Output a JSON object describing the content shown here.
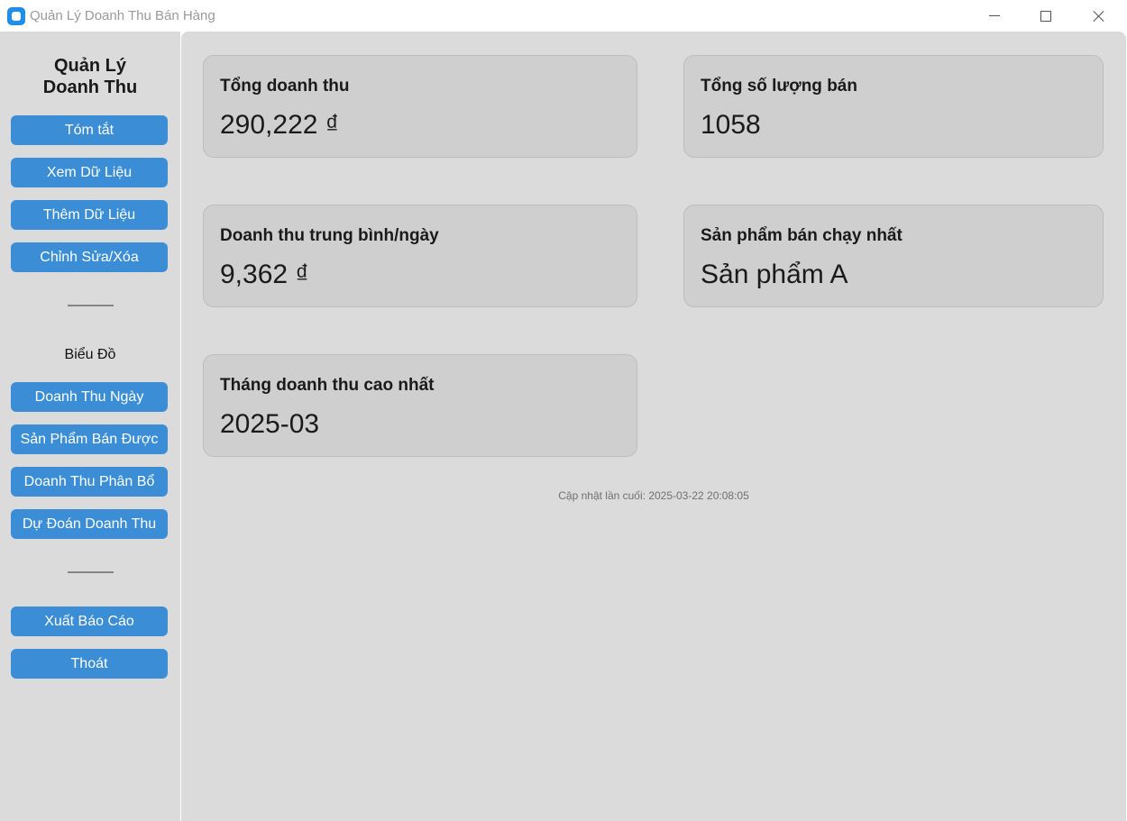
{
  "window": {
    "title": "Quản Lý Doanh Thu Bán Hàng",
    "controls": [
      "minimize-icon",
      "maximize-icon",
      "close-icon"
    ]
  },
  "sidebar": {
    "title_line1": "Quản Lý",
    "title_line2": "Doanh Thu",
    "nav_buttons": [
      "Tóm tắt",
      "Xem Dữ Liệu",
      "Thêm Dữ Liệu",
      "Chỉnh Sửa/Xóa"
    ],
    "separator1": "-----------------",
    "charts_label": "Biểu Đồ",
    "chart_buttons": [
      "Doanh Thu Ngày",
      "Sản Phẩm Bán Được",
      "Doanh Thu Phân Bổ",
      "Dự Đoán Doanh Thu"
    ],
    "separator2": "-----------------",
    "action_buttons": [
      "Xuất Báo Cáo",
      "Thoát"
    ]
  },
  "summary": {
    "cards": [
      {
        "title": "Tổng doanh thu",
        "value": "290,222 ₫"
      },
      {
        "title": "Tổng số lượng bán",
        "value": "1058"
      },
      {
        "title": "Doanh thu trung bình/ngày",
        "value": "9,362 ₫"
      },
      {
        "title": "Sản phẩm bán chạy nhất",
        "value": "Sản phẩm A"
      },
      {
        "title": "Tháng doanh thu cao nhất",
        "value": "2025-03"
      }
    ],
    "last_updated": "Cập nhật lần cuối: 2025-03-22 20:08:05"
  },
  "colors": {
    "accent": "#3b8ed6",
    "sidebar_bg": "#dbdbdb",
    "card_bg": "#cfcfcf"
  }
}
